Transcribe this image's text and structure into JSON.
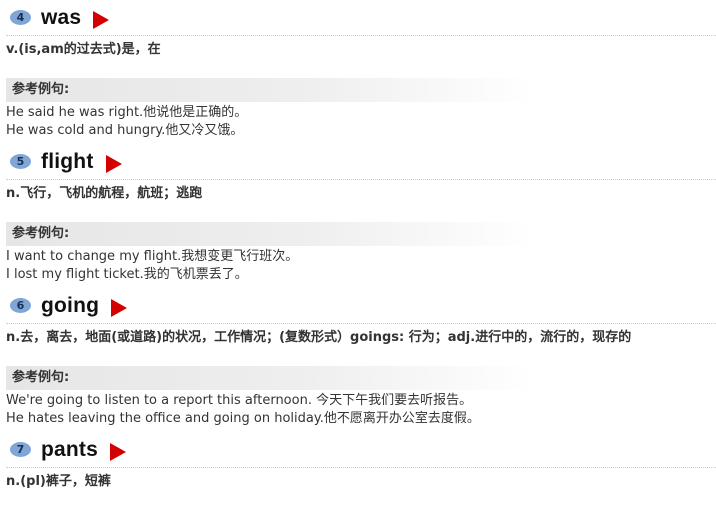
{
  "entries": [
    {
      "number": "4",
      "word": "was",
      "definition": "v.(is,am的过去式)是，在",
      "examples_label": "参考例句:",
      "examples": [
        "He said he was right.他说他是正确的。",
        "He was cold and hungry.他又冷又饿。"
      ]
    },
    {
      "number": "5",
      "word": "flight",
      "definition": "n.飞行，飞机的航程，航班；逃跑",
      "examples_label": "参考例句:",
      "examples": [
        "I want to change my flight.我想变更飞行班次。",
        "I lost my flight ticket.我的飞机票丢了。"
      ]
    },
    {
      "number": "6",
      "word": "going",
      "definition": "n.去，离去，地面(或道路)的状况，工作情况；(复数形式）goings: 行为；adj.进行中的，流行的，现存的",
      "examples_label": "参考例句:",
      "examples": [
        "We're going to listen to a report this afternoon. 今天下午我们要去听报告。",
        "He hates leaving the office and going on holiday.他不愿离开办公室去度假。"
      ]
    },
    {
      "number": "7",
      "word": "pants",
      "definition": "n.(pl)裤子，短裤"
    }
  ],
  "colors": {
    "badge": "#7fa6d6",
    "play": "#d40000"
  },
  "icons": {
    "play": "play-icon",
    "number": "number-badge"
  }
}
